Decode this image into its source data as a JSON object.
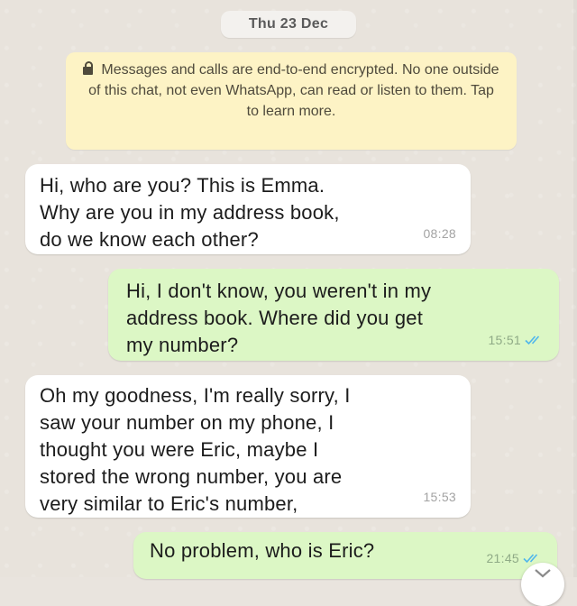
{
  "chat": {
    "date_label": "Thu 23 Dec",
    "encryption_notice": "Messages and calls are end-to-end encrypted. No one outside of this chat, not even WhatsApp, can read or listen to them. Tap to learn more."
  },
  "messages": [
    {
      "direction": "incoming",
      "text": "Hi, who are you? This is Emma.\nWhy are you in my address book,\ndo we know each other?",
      "time": "08:28"
    },
    {
      "direction": "outgoing",
      "text": "Hi, I don't know, you weren't in my\naddress book. Where did you get\nmy number?",
      "time": "15:51",
      "status": "read"
    },
    {
      "direction": "incoming",
      "text": "Oh my goodness, I'm really sorry, I\nsaw your number on my phone, I\nthought you were Eric, maybe I\nstored the wrong number, you are\nvery similar to Eric's number,",
      "time": "15:53"
    },
    {
      "direction": "outgoing",
      "text": "No problem, who is Eric?",
      "time": "21:45",
      "status": "read"
    }
  ],
  "colors": {
    "background": "#e8e3dc",
    "incoming_bubble": "#ffffff",
    "outgoing_bubble": "#dcf7c5",
    "notice_bubble": "#fdf3c5",
    "read_ticks": "#4fb6ec"
  },
  "icons": {
    "lock": "lock-icon",
    "read_receipt": "double-check-icon",
    "scroll_down": "chevron-down-icon"
  }
}
